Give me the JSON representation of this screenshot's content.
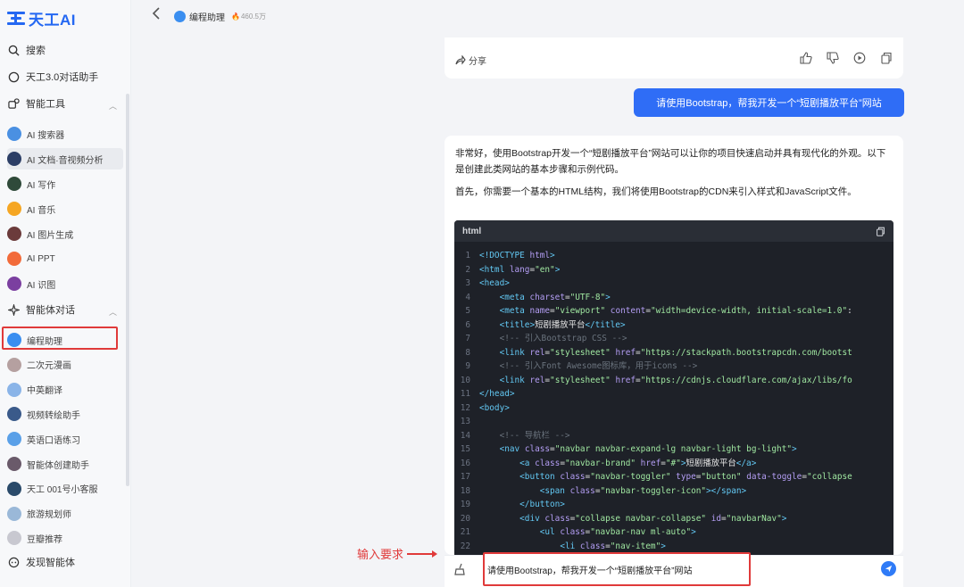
{
  "sidebar": {
    "logo_text": "天工AI",
    "search": "搜索",
    "assistant": "天工3.0对话助手",
    "tools_section": "智能工具",
    "tools": [
      {
        "label": "AI 搜索器",
        "color": "#4a90e2"
      },
      {
        "label": "AI 文档·音视频分析",
        "color": "#2c3e66"
      },
      {
        "label": "AI 写作",
        "color": "#2f4a3a"
      },
      {
        "label": "AI 音乐",
        "color": "#f5a623"
      },
      {
        "label": "AI 图片生成",
        "color": "#6b3b3b"
      },
      {
        "label": "AI PPT",
        "color": "#f26b3a"
      },
      {
        "label": "AI 识图",
        "color": "#7b3fa0"
      }
    ],
    "agents_section": "智能体对话",
    "agents": [
      {
        "label": "编程助理",
        "color": "#3a8ef0"
      },
      {
        "label": "二次元漫画",
        "color": "#b5a0a0"
      },
      {
        "label": "中英翻译",
        "color": "#8ab4e8"
      },
      {
        "label": "视频转绘助手",
        "color": "#3a5a8a"
      },
      {
        "label": "英语口语练习",
        "color": "#5aa0e8"
      },
      {
        "label": "智能体创建助手",
        "color": "#6a5a6a"
      },
      {
        "label": "天工 001号小客服",
        "color": "#2a4a6a"
      },
      {
        "label": "旅游规划师",
        "color": "#9ab8d8"
      },
      {
        "label": "豆瓣推荐",
        "color": "#c8c8d0"
      }
    ],
    "discover": "发现智能体"
  },
  "header": {
    "bot_name": "编程助理",
    "hot_count": "460.5万"
  },
  "chat": {
    "share_label": "分享",
    "user_message": "请使用Bootstrap，帮我开发一个“短剧播放平台”网站",
    "answer_p1": "非常好，使用Bootstrap开发一个“短剧播放平台”网站可以让你的项目快速启动并具有现代化的外观。以下是创建此类网站的基本步骤和示例代码。",
    "answer_p2": "首先，你需要一个基本的HTML结构，我们将使用Bootstrap的CDN来引入样式和JavaScript文件。",
    "code_lang": "html"
  },
  "input": {
    "value": "请使用Bootstrap，帮我开发一个“短剧播放平台”网站"
  },
  "annotation": {
    "label": "输入要求"
  },
  "colors": {
    "accent": "#2f6df6",
    "highlight_red": "#e03a3a",
    "code_bg": "#1e2128"
  }
}
